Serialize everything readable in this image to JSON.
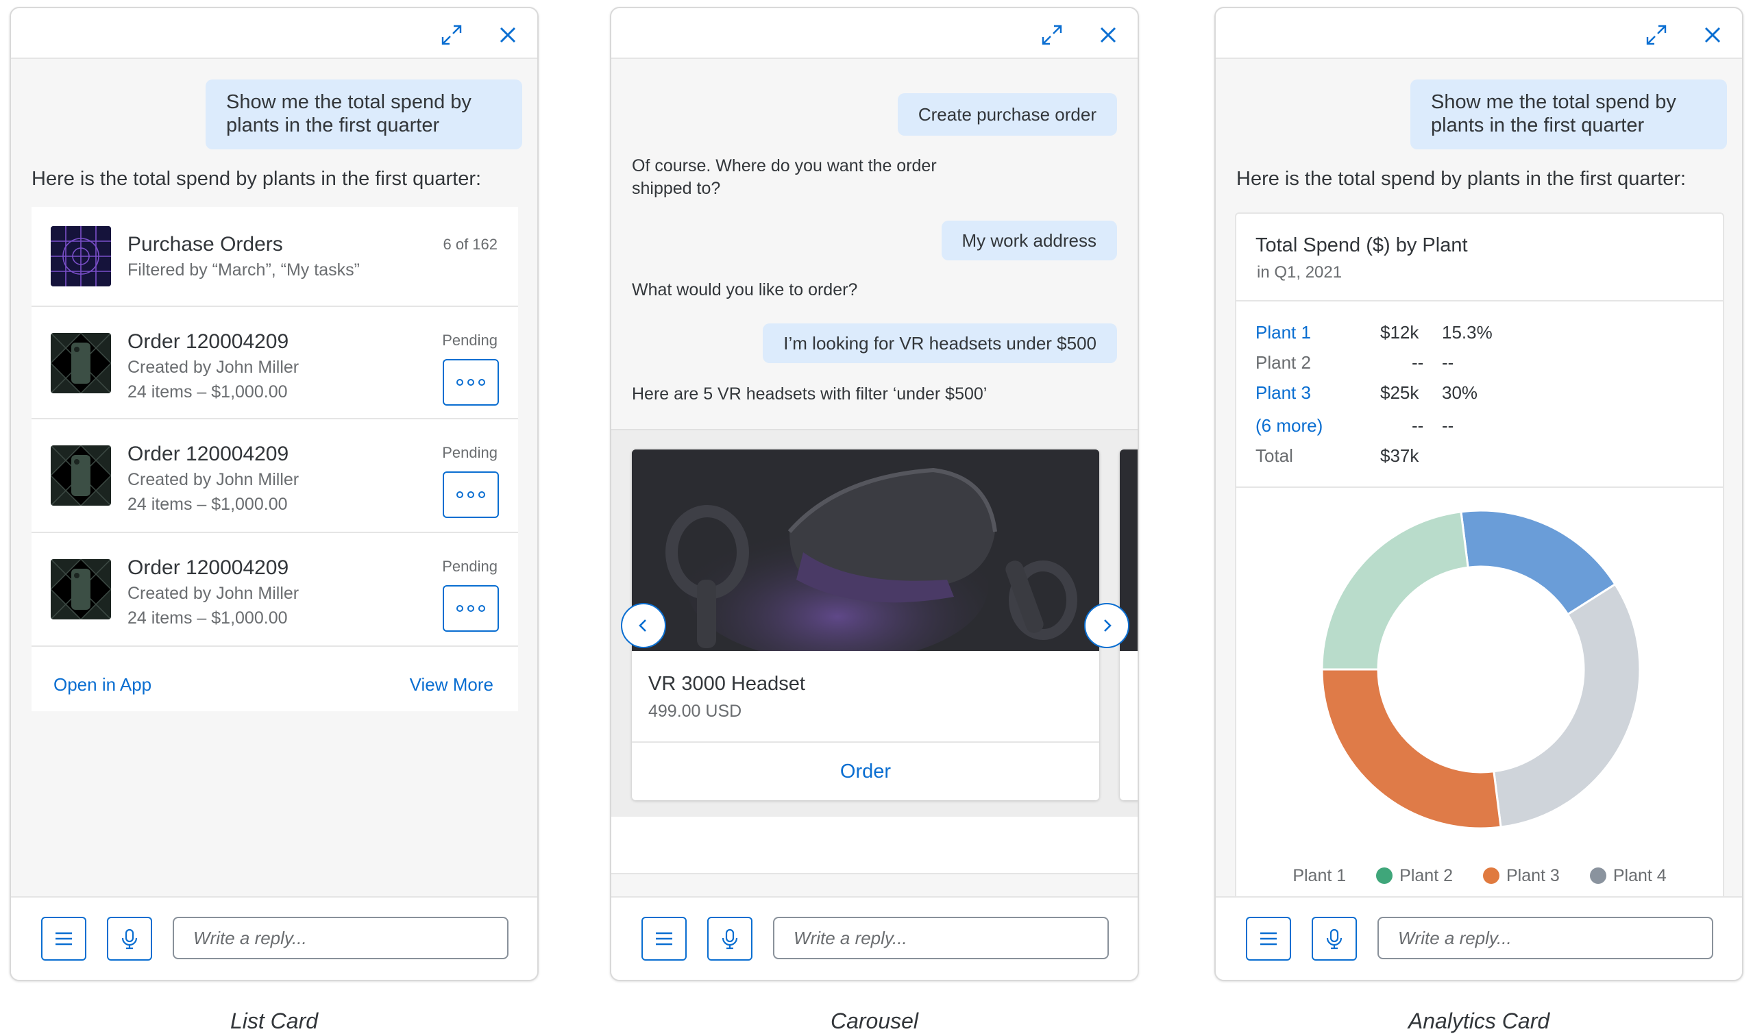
{
  "common": {
    "reply_placeholder": "Write a reply...",
    "accent_color": "#0a6ed1",
    "user_bubble_color": "#dcebfc"
  },
  "list_card": {
    "caption": "List Card",
    "user_message": "Show me the total spend by plants in the first quarter",
    "bot_message": "Here is the total spend by plants in the first quarter:",
    "header": {
      "title": "Purchase Orders",
      "subtitle": "Filtered by “March”, “My tasks”",
      "count": "6 of 162"
    },
    "items": [
      {
        "title": "Order 120004209",
        "created": "Created by John Miller",
        "summary": "24 items – $1,000.00",
        "status": "Pending"
      },
      {
        "title": "Order 120004209",
        "created": "Created by John Miller",
        "summary": "24 items – $1,000.00",
        "status": "Pending"
      },
      {
        "title": "Order 120004209",
        "created": "Created by John Miller",
        "summary": "24 items – $1,000.00",
        "status": "Pending"
      }
    ],
    "open_in_app": "Open in App",
    "view_more": "View More"
  },
  "carousel": {
    "caption": "Carousel",
    "messages": [
      {
        "from": "user",
        "text": "Create purchase order"
      },
      {
        "from": "bot",
        "text": "Of course. Where do you want the order shipped to?"
      },
      {
        "from": "user",
        "text": "My work address"
      },
      {
        "from": "bot",
        "text": "What would you like to order?"
      },
      {
        "from": "user",
        "text": "I’m looking for VR headsets under $500"
      },
      {
        "from": "bot",
        "text": "Here are 5 VR headsets with filter ‘under $500’"
      }
    ],
    "product": {
      "name": "VR 3000 Headset",
      "price": "499.00 USD",
      "action": "Order"
    }
  },
  "analytics_card": {
    "caption": "Analytics Card",
    "user_message": "Show me the total spend by plants in the first quarter",
    "bot_message": "Here is the total spend by plants in the first quarter:",
    "title": "Total Spend ($) by Plant",
    "subtitle": "in Q1, 2021",
    "rows": [
      {
        "label": "Plant 1",
        "value": "$12k",
        "pct": "15.3%",
        "link": true
      },
      {
        "label": "Plant 2",
        "value": "--",
        "pct": "--",
        "link": false
      },
      {
        "label": "Plant 3",
        "value": "$25k",
        "pct": "30%",
        "link": true
      },
      {
        "label": "(6 more)",
        "value": "--",
        "pct": "--",
        "link": true
      },
      {
        "label": "Total",
        "value": "$37k",
        "pct": "",
        "link": false
      }
    ],
    "legend": [
      {
        "name": "Plant 1",
        "color": "#5b9bd5"
      },
      {
        "name": "Plant 2",
        "color": "#3fa67a"
      },
      {
        "name": "Plant 3",
        "color": "#e07a3f"
      },
      {
        "name": "Plant 4",
        "color": "#8a939e"
      }
    ]
  },
  "chart_data": {
    "type": "pie",
    "variant": "donut",
    "categories": [
      "Plant 1",
      "Plant 4",
      "Plant 3",
      "Plant 2"
    ],
    "values": [
      18,
      32,
      27,
      23
    ],
    "colors": [
      "#6a9dd8",
      "#cfd4da",
      "#df7b48",
      "#b9dccb"
    ],
    "legend_placement": "bottom"
  }
}
